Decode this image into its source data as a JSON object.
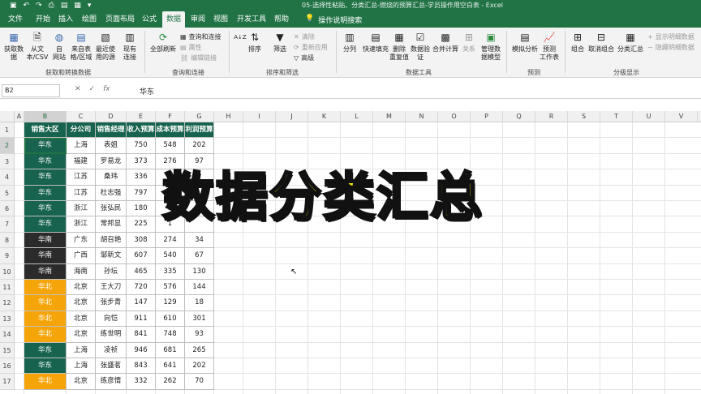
{
  "window": {
    "title": "05-选择性粘贴、分类汇总-燃烧的预算汇总-学员操作用空白表 - Excel"
  },
  "ribbon_tabs": [
    "文件",
    "开始",
    "插入",
    "绘图",
    "页面布局",
    "公式",
    "数据",
    "审阅",
    "视图",
    "开发工具",
    "帮助"
  ],
  "active_tab": "数据",
  "tell_me": "操作说明搜索",
  "ribbon": {
    "get_data": "获取数\n据",
    "from_csv": "从文\n本/CSV",
    "from_web": "自\n网站",
    "from_table": "来自表\n格/区域",
    "recent_sources": "最近使\n用的源",
    "existing_conn": "现有\n连接",
    "group_get": "获取和转换数据",
    "refresh_all": "全部刷新",
    "queries_conn": "查询和连接",
    "properties": "属性",
    "edit_links": "编辑链接",
    "group_queries": "查询和连接",
    "sort_az": "A↓Z",
    "sort": "排序",
    "filter": "筛选",
    "clear": "清除",
    "reapply": "重新应用",
    "advanced": "高级",
    "group_sort": "排序和筛选",
    "text_to_cols": "分列",
    "flash_fill": "快速填充",
    "remove_dup": "删除\n重复值",
    "data_valid": "数据验\n证",
    "consolidate": "合并计算",
    "relationships": "关系",
    "data_model": "管理数\n据模型",
    "group_tools": "数据工具",
    "what_if": "模拟分析",
    "forecast": "预测\n工作表",
    "group_forecast": "预测",
    "group_btn": "组合",
    "ungroup": "取消组合",
    "subtotal": "分类汇总",
    "show_detail": "显示明细数据",
    "hide_detail": "隐藏明细数据",
    "group_outline": "分级显示"
  },
  "formula_bar": {
    "name_box": "B2",
    "content": "华东"
  },
  "columns": [
    "A",
    "B",
    "C",
    "D",
    "E",
    "F",
    "G",
    "H",
    "I",
    "J",
    "K",
    "L",
    "M",
    "N",
    "O",
    "P",
    "Q",
    "R",
    "S",
    "T",
    "U",
    "V"
  ],
  "rows": [
    "1",
    "2",
    "3",
    "4",
    "5",
    "6",
    "7",
    "8",
    "9",
    "10",
    "11",
    "12",
    "13",
    "14",
    "15",
    "16",
    "17"
  ],
  "table": {
    "headers": [
      "销售大区",
      "分公司",
      "销售经理",
      "收入预算",
      "成本预算",
      "利润预算"
    ],
    "header_color": "#17634f",
    "region_colors": {
      "华东": "#17634f",
      "华南": "#2b2b2b",
      "华北": "#f5a50a"
    },
    "rows": [
      [
        "华东",
        "上海",
        "表姐",
        "750",
        "548",
        "202"
      ],
      [
        "华东",
        "福建",
        "罗易龙",
        "373",
        "276",
        "97"
      ],
      [
        "华东",
        "江苏",
        "桑玮",
        "336",
        "2",
        ""
      ],
      [
        "华东",
        "江苏",
        "杜志强",
        "797",
        "6",
        ""
      ],
      [
        "华东",
        "浙江",
        "张弘民",
        "180",
        "1",
        ""
      ],
      [
        "华东",
        "浙江",
        "常邦显",
        "225",
        "1",
        ""
      ],
      [
        "华南",
        "广东",
        "胡召艳",
        "308",
        "274",
        "34"
      ],
      [
        "华南",
        "广西",
        "邹新文",
        "607",
        "540",
        "67"
      ],
      [
        "华南",
        "海南",
        "孙坛",
        "465",
        "335",
        "130"
      ],
      [
        "华北",
        "北京",
        "王大刀",
        "720",
        "576",
        "144"
      ],
      [
        "华北",
        "北京",
        "张步青",
        "147",
        "129",
        "18"
      ],
      [
        "华北",
        "北京",
        "向恺",
        "911",
        "610",
        "301"
      ],
      [
        "华北",
        "北京",
        "练世明",
        "841",
        "748",
        "93"
      ],
      [
        "华东",
        "上海",
        "凌祯",
        "946",
        "681",
        "265"
      ],
      [
        "华东",
        "上海",
        "张盛茗",
        "843",
        "641",
        "202"
      ],
      [
        "华北",
        "北京",
        "练彦情",
        "332",
        "262",
        "70"
      ]
    ]
  },
  "overlay_text": "数据分类汇总"
}
